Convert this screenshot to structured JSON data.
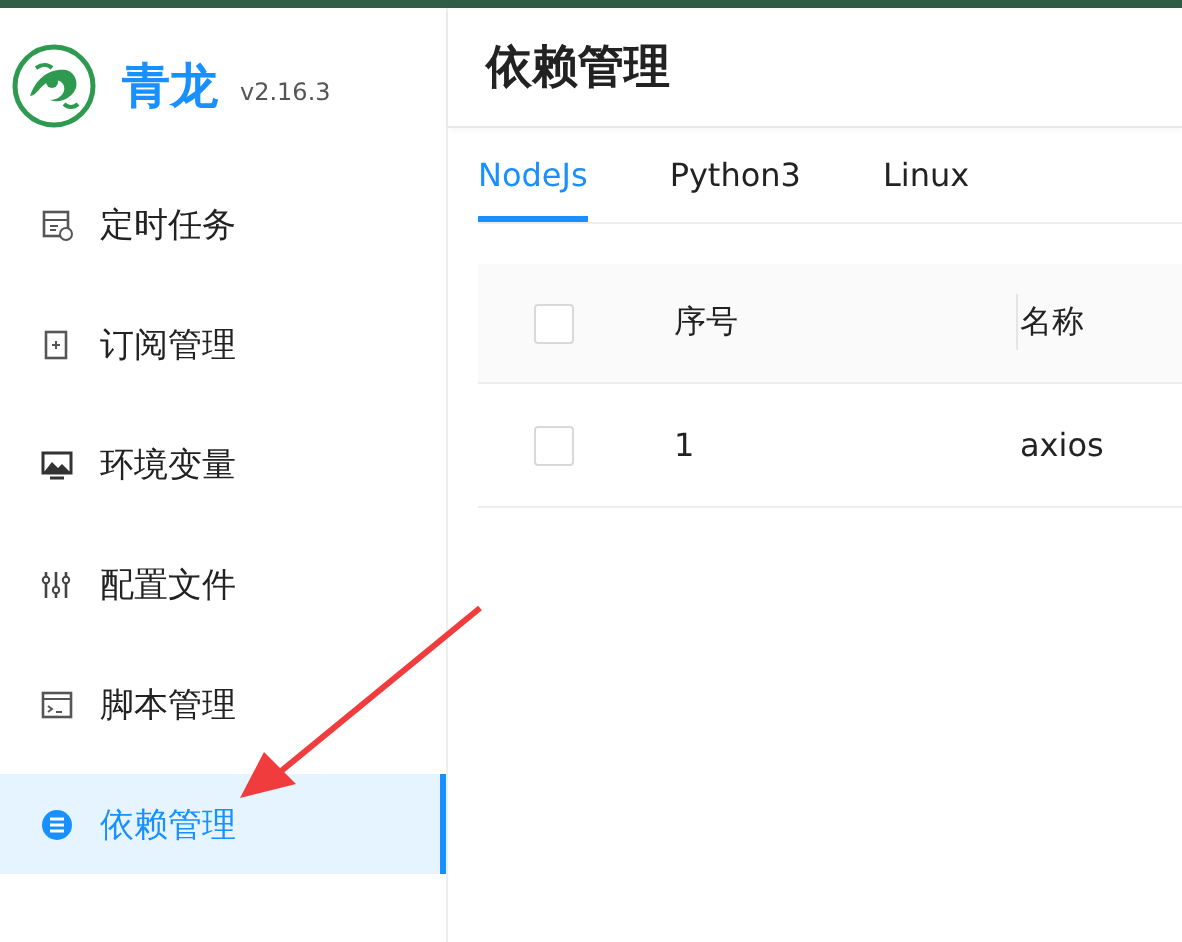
{
  "app": {
    "name": "青龙",
    "version": "v2.16.3"
  },
  "sidebar": {
    "items": [
      {
        "label": "定时任务",
        "selected": false
      },
      {
        "label": "订阅管理",
        "selected": false
      },
      {
        "label": "环境变量",
        "selected": false
      },
      {
        "label": "配置文件",
        "selected": false
      },
      {
        "label": "脚本管理",
        "selected": false
      },
      {
        "label": "依赖管理",
        "selected": true
      }
    ]
  },
  "page": {
    "title": "依赖管理"
  },
  "tabs": [
    {
      "label": "NodeJs",
      "selected": true
    },
    {
      "label": "Python3",
      "selected": false
    },
    {
      "label": "Linux",
      "selected": false
    }
  ],
  "table": {
    "columns": [
      "序号",
      "名称"
    ],
    "rows": [
      {
        "checked": false,
        "cells": [
          "1",
          "axios"
        ]
      }
    ],
    "header_checked": false
  }
}
